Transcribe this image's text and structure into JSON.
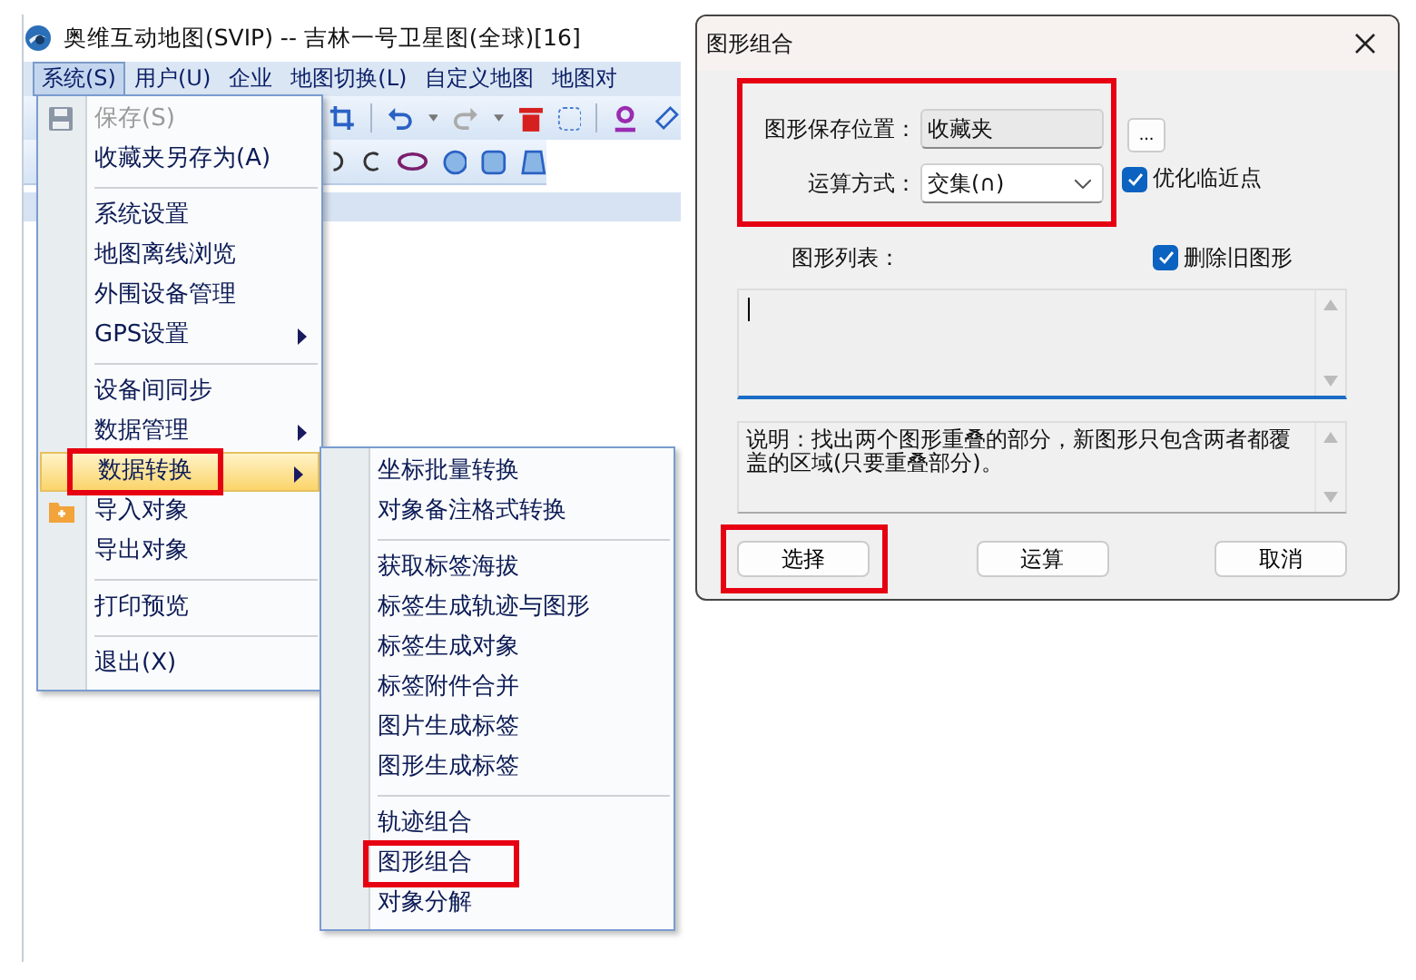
{
  "app": {
    "title": "奥维互动地图(SVIP) -- 吉林一号卫星图(全球)[16]",
    "menubar": [
      {
        "label": "系统(S)",
        "selected": true
      },
      {
        "label": "用户(U)",
        "selected": false
      },
      {
        "label": "企业",
        "selected": false
      },
      {
        "label": "地图切换(L)",
        "selected": false
      },
      {
        "label": "自定义地图",
        "selected": false
      },
      {
        "label": "地图对",
        "selected": false
      }
    ],
    "menu": [
      {
        "kind": "item",
        "label": "保存(S)",
        "disabled": true,
        "selected": false,
        "submenu": false,
        "annotated": false
      },
      {
        "kind": "item",
        "label": "收藏夹另存为(A)",
        "disabled": false,
        "selected": false,
        "submenu": false,
        "annotated": false
      },
      {
        "kind": "separator"
      },
      {
        "kind": "item",
        "label": "系统设置",
        "disabled": false,
        "selected": false,
        "submenu": false,
        "annotated": false
      },
      {
        "kind": "item",
        "label": "地图离线浏览",
        "disabled": false,
        "selected": false,
        "submenu": false,
        "annotated": false
      },
      {
        "kind": "item",
        "label": "外围设备管理",
        "disabled": false,
        "selected": false,
        "submenu": false,
        "annotated": false
      },
      {
        "kind": "item",
        "label": "GPS设置",
        "disabled": false,
        "selected": false,
        "submenu": true,
        "annotated": false
      },
      {
        "kind": "separator"
      },
      {
        "kind": "item",
        "label": "设备间同步",
        "disabled": false,
        "selected": false,
        "submenu": false,
        "annotated": false
      },
      {
        "kind": "item",
        "label": "数据管理",
        "disabled": false,
        "selected": false,
        "submenu": true,
        "annotated": false
      },
      {
        "kind": "item",
        "label": "数据转换",
        "disabled": false,
        "selected": true,
        "submenu": true,
        "annotated": true
      },
      {
        "kind": "item",
        "label": "导入对象",
        "disabled": false,
        "selected": false,
        "submenu": false,
        "annotated": false
      },
      {
        "kind": "item",
        "label": "导出对象",
        "disabled": false,
        "selected": false,
        "submenu": false,
        "annotated": false
      },
      {
        "kind": "separator"
      },
      {
        "kind": "item",
        "label": "打印预览",
        "disabled": false,
        "selected": false,
        "submenu": false,
        "annotated": false
      },
      {
        "kind": "separator"
      },
      {
        "kind": "item",
        "label": "退出(X)",
        "disabled": false,
        "selected": false,
        "submenu": false,
        "annotated": false
      }
    ],
    "submenu": [
      {
        "kind": "item",
        "label": "坐标批量转换",
        "annotated": false
      },
      {
        "kind": "item",
        "label": "对象备注格式转换",
        "annotated": false
      },
      {
        "kind": "separator"
      },
      {
        "kind": "item",
        "label": "获取标签海拔",
        "annotated": false
      },
      {
        "kind": "item",
        "label": "标签生成轨迹与图形",
        "annotated": false
      },
      {
        "kind": "item",
        "label": "标签生成对象",
        "annotated": false
      },
      {
        "kind": "item",
        "label": "标签附件合并",
        "annotated": false
      },
      {
        "kind": "item",
        "label": "图片生成标签",
        "annotated": false
      },
      {
        "kind": "item",
        "label": "图形生成标签",
        "annotated": false
      },
      {
        "kind": "separator"
      },
      {
        "kind": "item",
        "label": "轨迹组合",
        "annotated": false
      },
      {
        "kind": "item",
        "label": "图形组合",
        "annotated": true
      },
      {
        "kind": "item",
        "label": "对象分解",
        "annotated": false
      }
    ]
  },
  "dialog": {
    "title": "图形组合",
    "fields_annotated": true,
    "save_location": {
      "label": "图形保存位置：",
      "value": "收藏夹",
      "browse": "..."
    },
    "operation": {
      "label": "运算方式：",
      "value": "交集(∩)",
      "option": {
        "label": "优化临近点",
        "checked": true
      }
    },
    "list": {
      "label": "图形列表：",
      "option": {
        "label": "删除旧图形",
        "checked": true
      }
    },
    "description": "说明：找出两个图形重叠的部分，新图形只包含两者都覆盖的区域(只要重叠部分)。",
    "buttons": [
      {
        "label": "选择",
        "annotated": true
      },
      {
        "label": "运算",
        "annotated": false
      },
      {
        "label": "取消",
        "annotated": false
      }
    ]
  }
}
